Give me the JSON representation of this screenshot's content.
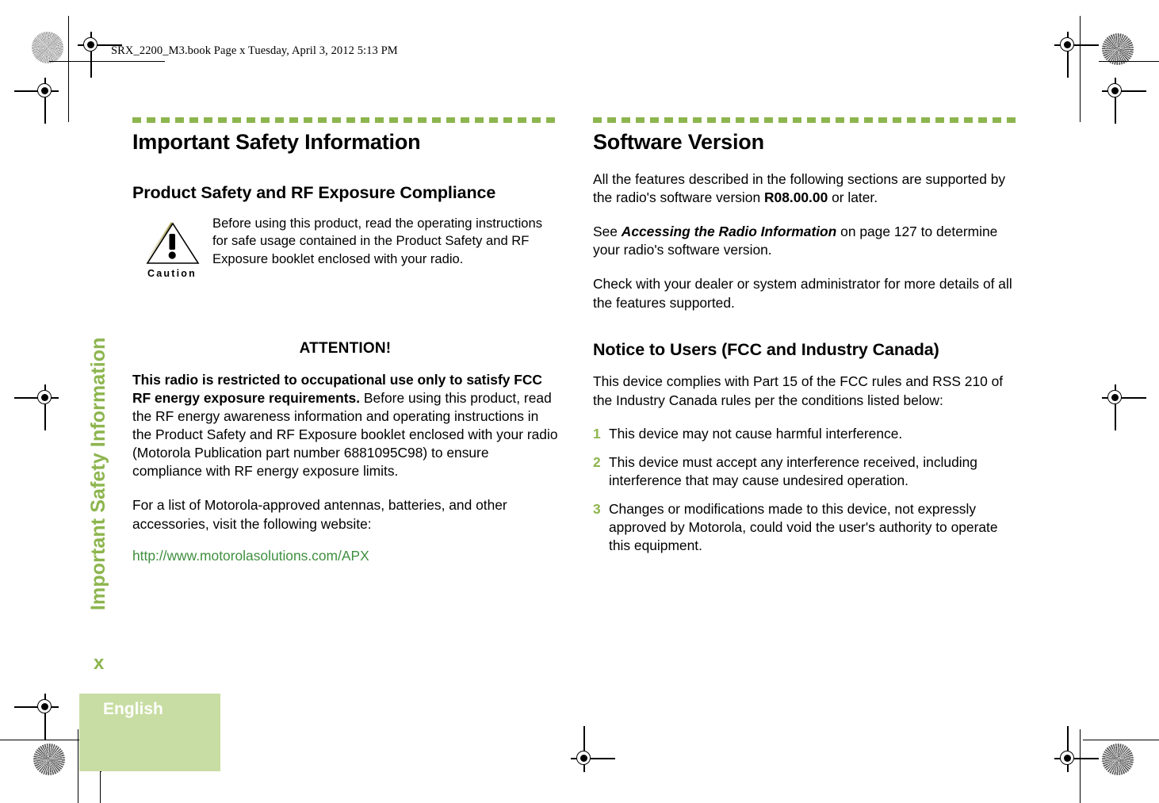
{
  "running_header": "SRX_2200_M3.book  Page x  Tuesday, April 3, 2012  5:13 PM",
  "side_tab": "Important Safety Information",
  "colors": {
    "accent_green": "#8DB54E",
    "band_green": "#C8DDA3",
    "url_green": "#3f8f3f"
  },
  "left_column": {
    "chapter_title": "Important Safety Information",
    "section_title": "Product Safety and RF Exposure Compliance",
    "caution": {
      "icon_label": "Caution",
      "text": "Before using this product, read the operating instructions for safe usage contained in the Product Safety and RF Exposure booklet enclosed with your radio."
    },
    "attention_heading": "ATTENTION!",
    "attention_bold": "This radio is restricted to occupational use only to satisfy FCC RF energy exposure requirements.",
    "attention_body": "Before using this product, read the RF energy awareness information and operating instructions in the Product Safety and RF Exposure booklet enclosed with your radio (Motorola Publication part number 6881095C98) to ensure compliance with RF energy exposure limits.",
    "antenna_paragraph": "For a list of Motorola-approved antennas, batteries, and other accessories, visit the following website:",
    "url": "http://www.motorolasolutions.com/APX"
  },
  "right_column": {
    "section_title": "Software Version",
    "software_paragraph": {
      "before": "All the features described in the following sections are supported by the radio's software version ",
      "version": "R08.00.00",
      "after": " or later."
    },
    "see_paragraph": {
      "before": "See ",
      "reference": "Accessing the Radio Information",
      "after": " on page 127 to determine your radio's software version."
    },
    "check_paragraph": "Check with your dealer or system administrator for more details of all the features supported.",
    "notice_title": "Notice to Users (FCC and Industry Canada)",
    "notice_intro": "This device complies with Part 15 of the FCC rules and RSS 210 of the Industry Canada rules per the conditions listed below:",
    "notice_items": [
      {
        "num": "1",
        "text": "This device may not cause harmful  interference."
      },
      {
        "num": "2",
        "text": "This device must accept any interference received, including interference that may cause undesired operation."
      },
      {
        "num": "3",
        "text": "Changes or modifications made to this device, not expressly approved by Motorola, could void the user's authority to operate this equipment."
      }
    ]
  },
  "footer": {
    "folio": "x",
    "language": "English"
  }
}
